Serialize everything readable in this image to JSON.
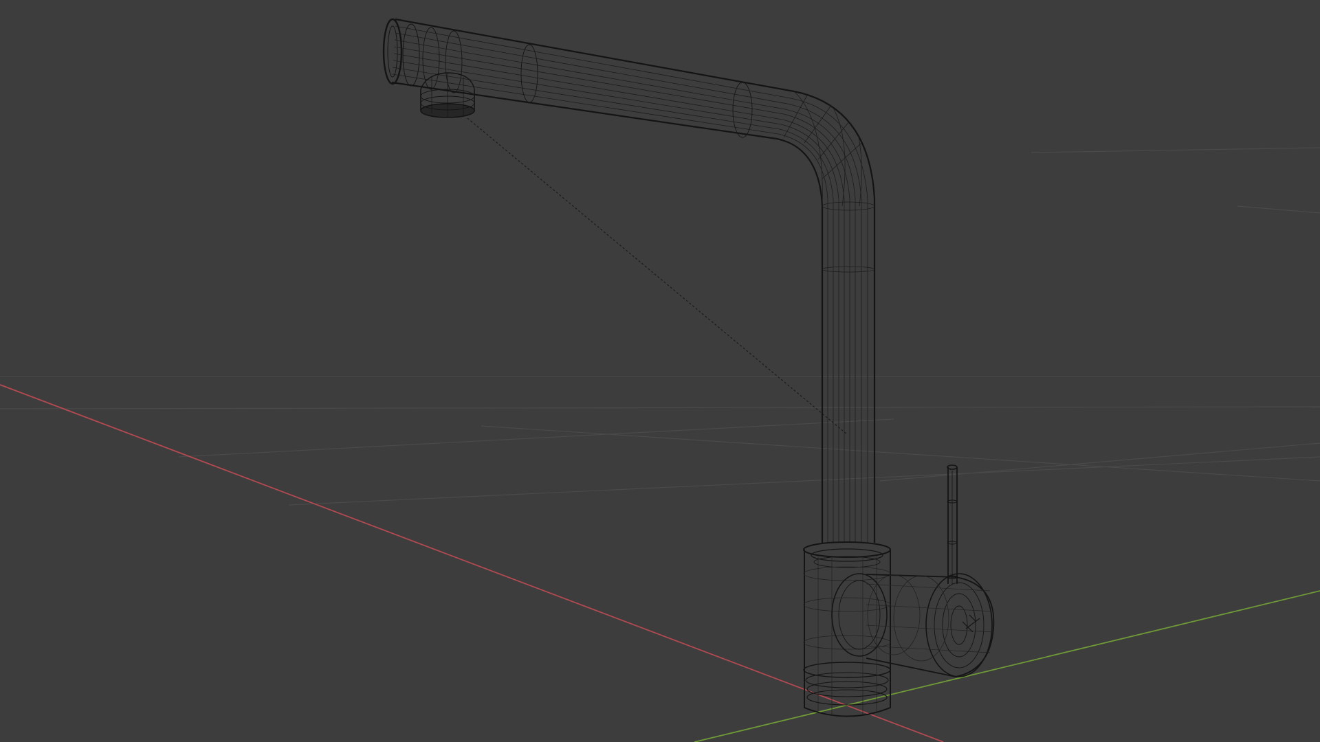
{
  "viewport": {
    "mode": "wireframe",
    "object": "kitchen-faucet",
    "colors": {
      "background": "#3d3d3d",
      "grid": "#4a4a4a",
      "axis_x": "#b34a52",
      "axis_y": "#6f9a37",
      "wire": "#141414",
      "wire_light": "#2a2a2a"
    }
  }
}
